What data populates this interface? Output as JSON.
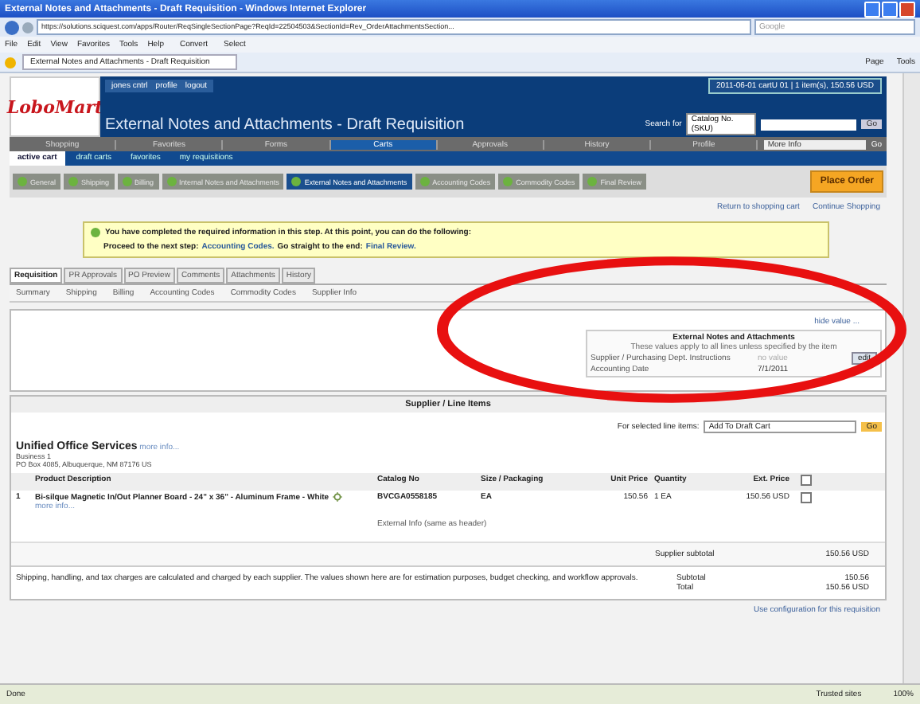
{
  "window": {
    "title": "External Notes and Attachments - Draft Requisition - Windows Internet Explorer",
    "address": "https://solutions.sciquest.com/apps/Router/ReqSingleSectionPage?ReqId=22504503&SectionId=Rev_OrderAttachmentsSection...",
    "search_placeholder": "Google",
    "menu": [
      "File",
      "Edit",
      "View",
      "Favorites",
      "Tools",
      "Help"
    ],
    "toolbar": [
      "Convert",
      "Select"
    ],
    "tab": "External Notes and Attachments - Draft Requisition",
    "right_tools": [
      "Page",
      "Tools"
    ]
  },
  "header": {
    "logo": "LoboMart",
    "user_links": [
      "jones cntrl",
      "profile",
      "logout"
    ],
    "title": "External Notes and Attachments - Draft Requisition",
    "cart_info": "2011-06-01 cartU 01 | 1 item(s), 150.56 USD",
    "search_label": "Search for",
    "search_select": "Catalog No. (SKU)",
    "search_button": "Go"
  },
  "nav": [
    {
      "label": "Shopping",
      "selected": false
    },
    {
      "label": "Favorites",
      "selected": false
    },
    {
      "label": "Forms",
      "selected": false
    },
    {
      "label": "Carts",
      "selected": true
    },
    {
      "label": "Approvals",
      "selected": false
    },
    {
      "label": "History",
      "selected": false
    },
    {
      "label": "Profile",
      "selected": false
    }
  ],
  "nav_select": "More Info",
  "nav_button": "Go",
  "subnav": [
    {
      "label": "active cart",
      "selected": true
    },
    {
      "label": "draft carts",
      "selected": false
    },
    {
      "label": "favorites",
      "selected": false
    },
    {
      "label": "my requisitions",
      "selected": false
    }
  ],
  "steps": [
    {
      "label": "General",
      "selected": false
    },
    {
      "label": "Shipping",
      "selected": false
    },
    {
      "label": "Billing",
      "selected": false
    },
    {
      "label": "Internal Notes and Attachments",
      "selected": false
    },
    {
      "label": "External Notes and Attachments",
      "selected": true
    },
    {
      "label": "Accounting Codes",
      "selected": false
    },
    {
      "label": "Commodity Codes",
      "selected": false
    },
    {
      "label": "Final Review",
      "selected": false
    }
  ],
  "place_order": "Place Order",
  "links": [
    "Return to shopping cart",
    "Continue Shopping"
  ],
  "notice": {
    "line1": "You have completed the required information in this step. At this point, you can do the following:",
    "proceed_label": "Proceed to the next step:",
    "proceed_link": "Accounting Codes.",
    "end_label": "Go straight to the end:",
    "end_link": "Final Review."
  },
  "doc_tabs": [
    {
      "label": "Requisition",
      "selected": true
    },
    {
      "label": "PR Approvals",
      "selected": false
    },
    {
      "label": "PO Preview",
      "selected": false
    },
    {
      "label": "Comments",
      "selected": false
    },
    {
      "label": "Attachments",
      "selected": false
    },
    {
      "label": "History",
      "selected": false
    }
  ],
  "sub_tabs": [
    "Summary",
    "Shipping",
    "Billing",
    "Accounting Codes",
    "Commodity Codes",
    "Supplier Info"
  ],
  "notes": {
    "hide_link": "hide value ...",
    "title": "External Notes and Attachments",
    "subtitle": "These values apply to all lines unless specified by the item",
    "fields": [
      {
        "label": "Supplier / Purchasing Dept. Instructions",
        "value": "no value"
      },
      {
        "label": "Accounting Date",
        "value": "7/1/2011"
      }
    ],
    "edit": "edit"
  },
  "lines": {
    "title": "Supplier / Line Items",
    "selected_label": "For selected line items:",
    "select": "Add To Draft Cart",
    "go": "Go"
  },
  "supplier": {
    "name": "Unified Office Services",
    "more": "more info...",
    "business": "Business 1",
    "address": "PO Box 4085, Albuquerque, NM 87176 US"
  },
  "table": {
    "columns": [
      "Product Description",
      "Catalog No",
      "Size / Packaging",
      "Unit Price",
      "Quantity",
      "Ext. Price"
    ],
    "rows": [
      {
        "num": "1",
        "description": "Bi-silque Magnetic In/Out Planner Board - 24\" x 36\" - Aluminum Frame - White",
        "more": "more info...",
        "catalog": "BVCGA0558185",
        "size": "EA",
        "unit_price": "150.56",
        "quantity": "1 EA",
        "ext_price": "150.56 USD",
        "checked": false,
        "external": "External Info (same as header)"
      }
    ],
    "header_checked": false,
    "subtotal_label": "Supplier subtotal",
    "subtotal": "150.56 USD"
  },
  "footer": {
    "note": "Shipping, handling, and tax charges are calculated and charged by each supplier. The values shown here are for estimation purposes, budget checking, and workflow approvals.",
    "subtotal_label": "Subtotal",
    "subtotal": "150.56",
    "total_label": "Total",
    "total": "150.56 USD",
    "config_link": "Use configuration for this requisition"
  },
  "status_bar": {
    "text": "Done",
    "zone": "Trusted sites",
    "zoom": "100%"
  }
}
